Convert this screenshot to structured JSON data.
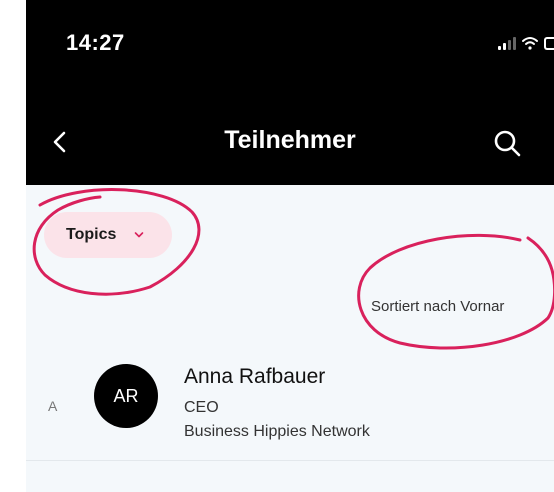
{
  "status_bar": {
    "time": "14:27"
  },
  "header": {
    "title": "Teilnehmer"
  },
  "filters": {
    "topics_label": "Topics"
  },
  "sort": {
    "label": "Sortiert nach Vornar"
  },
  "participants": [
    {
      "section_letter": "A",
      "initials": "AR",
      "name": "Anna Rafbauer",
      "role": "CEO",
      "company": "Business Hippies Network"
    }
  ],
  "colors": {
    "header_bg": "#000000",
    "page_bg": "#f4f8fb",
    "chip_bg": "#fbe3e9",
    "accent": "#d9215c",
    "annotation": "#d9215c"
  }
}
